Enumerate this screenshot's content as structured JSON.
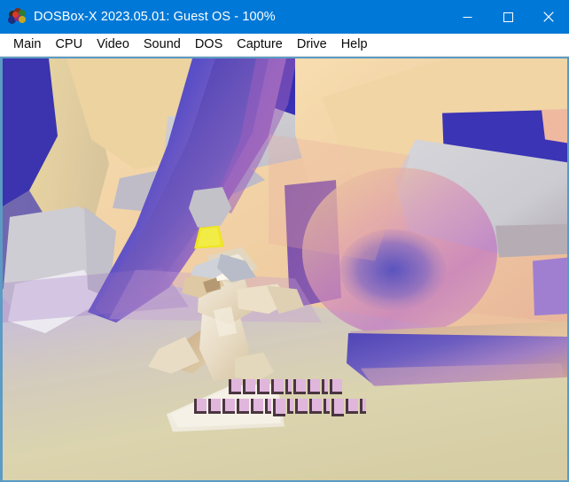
{
  "window": {
    "title": "DOSBox-X 2023.05.01: Guest OS - 100%",
    "app_icon": "dosbox-x-logo-icon",
    "titlebar_color": "#0078d7",
    "title_text_color": "#ffffff",
    "border_color": "#5b9bc4",
    "controls": [
      {
        "name": "minimize-button",
        "glyph": "minimize-icon",
        "label": "Minimize"
      },
      {
        "name": "maximize-button",
        "glyph": "maximize-icon",
        "label": "Maximize"
      },
      {
        "name": "close-button",
        "glyph": "close-icon",
        "label": "Close"
      }
    ]
  },
  "menubar": {
    "background": "#ffffff",
    "items": [
      {
        "label": "Main",
        "name": "menu-item-main"
      },
      {
        "label": "CPU",
        "name": "menu-item-cpu"
      },
      {
        "label": "Video",
        "name": "menu-item-video"
      },
      {
        "label": "Sound",
        "name": "menu-item-sound"
      },
      {
        "label": "DOS",
        "name": "menu-item-dos"
      },
      {
        "label": "Capture",
        "name": "menu-item-capture"
      },
      {
        "label": "Drive",
        "name": "menu-item-drive"
      },
      {
        "label": "Help",
        "name": "menu-item-help"
      }
    ]
  },
  "guest_screen": {
    "description": "3D flat/gouraud shaded DOS game scene: pale tan cave interior with large sloping rock walls, a violet-blue crevice running diagonally, a light-grey ledge upper right, a purple-blue rock shelf at right-centre, a cream-coloured dinosaur-like creature standing centre, a white paper sheet lying on the sandy floor, and two rows of corrupted pink text glyphs at the bottom.",
    "floor_color": "#d9cfa8",
    "wall_color": "#f2d6a8",
    "crevice_color": "#3b34ae",
    "accent_magenta": "#c07ac0",
    "creature_color": "#efe4cf",
    "paper_color": "#f3eee1",
    "glyph_fill": "#e0b6dd",
    "glyph_outline": "#4a3540",
    "text_rows": [
      {
        "name": "corrupt-text-row-1",
        "glyph_count": 9
      },
      {
        "name": "corrupt-text-row-2",
        "glyph_count": 14
      }
    ]
  }
}
